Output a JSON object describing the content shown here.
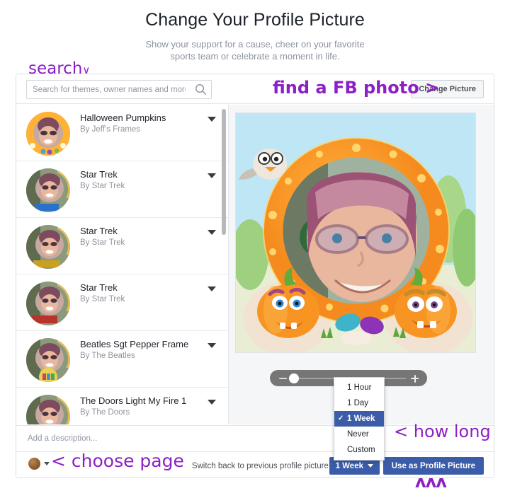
{
  "header": {
    "title": "Change Your Profile Picture",
    "subtitle": "Show your support for a cause, cheer on your favorite sports team or celebrate a moment in life."
  },
  "annotations": {
    "search": "search",
    "search_caret": "∨",
    "find_fb_photo": "find a FB photo >",
    "how_long": "< how long",
    "choose_page": "< choose page",
    "up_carets": "ʌʌʌ"
  },
  "toolbar": {
    "search_placeholder": "Search for themes, owner names and more.",
    "search_value": "",
    "search_icon": "search-icon",
    "change_picture_label": "Change Picture"
  },
  "frames": [
    {
      "title": "Halloween Pumpkins",
      "author": "By Jeff's Frames"
    },
    {
      "title": "Star Trek",
      "author": "By Star Trek"
    },
    {
      "title": "Star Trek",
      "author": "By Star Trek"
    },
    {
      "title": "Star Trek",
      "author": "By Star Trek"
    },
    {
      "title": "Beatles Sgt Pepper Frame",
      "author": "By The Beatles"
    },
    {
      "title": "The Doors Light My Fire 1",
      "author": "By The Doors"
    }
  ],
  "preview": {
    "frame_name": "Halloween Pumpkins",
    "zoom_minus": "−",
    "zoom_plus": "+"
  },
  "description": {
    "placeholder": "Add a description...",
    "value": ""
  },
  "footer": {
    "page_chooser_icon": "page-avatar-icon",
    "switch_back_label": "Switch back to previous profile picture in",
    "duration_value": "1 Week",
    "use_button_label": "Use as Profile Picture"
  },
  "duration_menu": {
    "open": true,
    "selected": "1 Week",
    "check_glyph": "✓",
    "options": [
      "1 Hour",
      "1 Day",
      "1 Week",
      "Never",
      "Custom"
    ]
  },
  "colors": {
    "accent_blue": "#3b5ca8",
    "annotation_purple": "#8c20c4",
    "text_dark": "#1d2129",
    "text_muted": "#90949c",
    "card_border": "#dcdee3"
  }
}
